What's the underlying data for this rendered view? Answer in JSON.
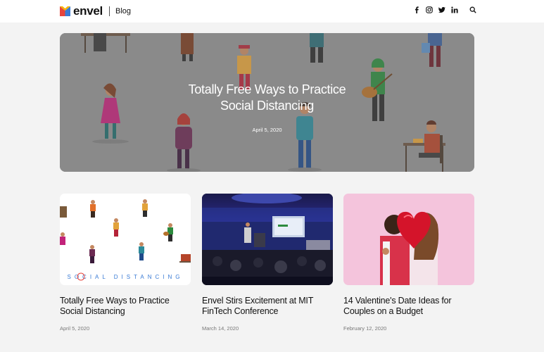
{
  "header": {
    "brand": "envel",
    "section": "Blog",
    "social_icons": [
      "facebook-icon",
      "instagram-icon",
      "twitter-icon",
      "linkedin-icon"
    ],
    "search_icon": "search-icon"
  },
  "hero": {
    "title_line1": "Totally Free Ways to Practice",
    "title_line2": "Social Distancing",
    "date": "April 5, 2020"
  },
  "posts": [
    {
      "title_line1": "Totally Free Ways to Practice",
      "title_line2": "Social Distancing",
      "date": "April 5, 2020",
      "image_caption": "SOCIAL DISTANCING"
    },
    {
      "title_line1": "Envel Stirs Excitement at MIT",
      "title_line2": "FinTech Conference",
      "date": "March 14, 2020"
    },
    {
      "title_line1": "14 Valentine's Date Ideas for",
      "title_line2": "Couples on a Budget",
      "date": "February 12, 2020"
    }
  ],
  "colors": {
    "hero_bg": "#919191",
    "page_bg": "#f3f3f3",
    "brand_red": "#e8453c",
    "brand_blue": "#3a7bd5"
  }
}
